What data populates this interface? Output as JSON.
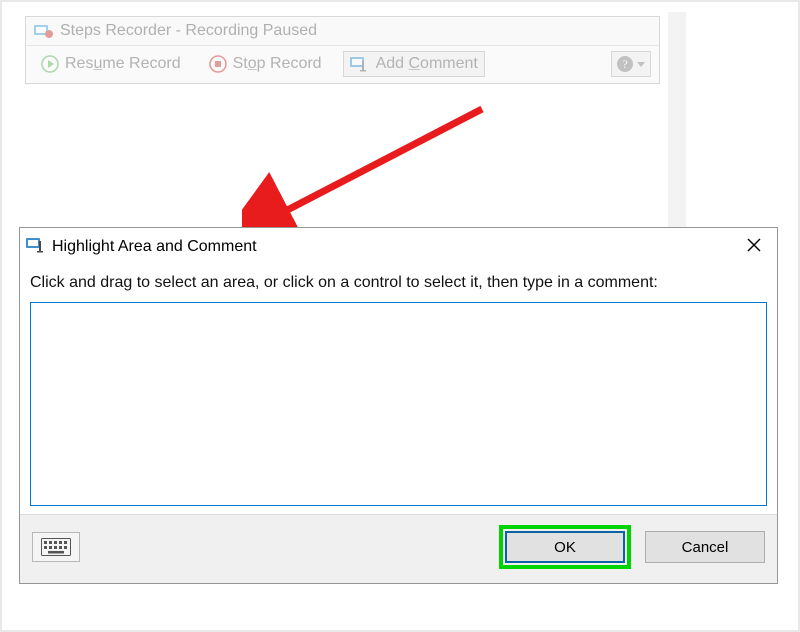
{
  "recorder": {
    "title": "Steps Recorder - Recording Paused",
    "resume_prefix": "Res",
    "resume_underline": "u",
    "resume_suffix": "me Record",
    "stop_prefix": "St",
    "stop_underline": "o",
    "stop_suffix": "p Record",
    "comment_prefix": "Add ",
    "comment_underline": "C",
    "comment_suffix": "omment"
  },
  "dialog": {
    "title": "Highlight Area and Comment",
    "instructions": "Click and drag to select an area, or click on a control to select it, then type in a comment:",
    "text_value": "",
    "ok_label": "OK",
    "cancel_label": "Cancel"
  }
}
